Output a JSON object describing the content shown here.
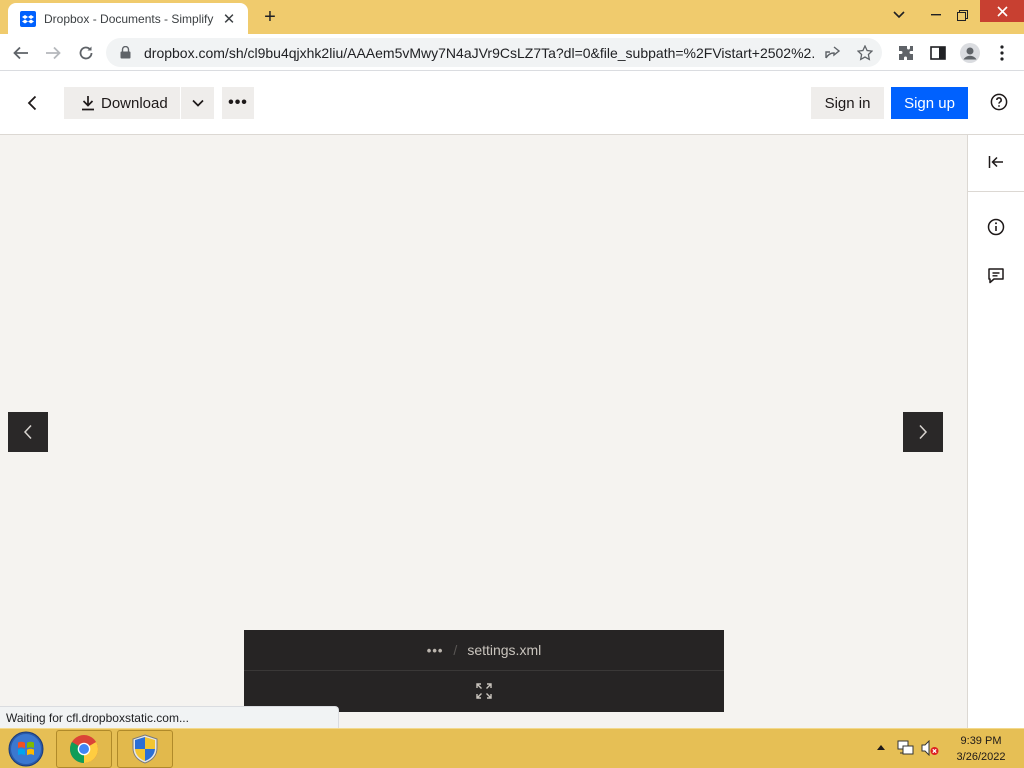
{
  "browser": {
    "tab_title": "Dropbox - Documents - Simplify",
    "new_tab_label": "+",
    "url": "dropbox.com/sh/cl9bu4qjxhk2liu/AAAem5vMwy7N4aJVr9CsLZ7Ta?dl=0&file_subpath=%2FVistart+2502%2..."
  },
  "header": {
    "download_label": "Download",
    "more_label": "•••",
    "sign_in_label": "Sign in",
    "sign_up_label": "Sign up"
  },
  "viewer": {
    "path_ellipsis": "•••",
    "path_separator": "/",
    "file_name": "settings.xml"
  },
  "status_text": "Waiting for cfl.dropboxstatic.com...",
  "taskbar": {
    "time": "9:39 PM",
    "date": "3/26/2022"
  },
  "colors": {
    "accent": "#0061fe",
    "tabstrip": "#f0cb6d",
    "taskbar": "#e6bf55",
    "preview_bg": "#f5f3f0",
    "file_bar": "#262424"
  },
  "icons": [
    "dropbox-icon",
    "close-icon",
    "plus-icon",
    "chevron-down-icon",
    "minimize-icon",
    "restore-icon",
    "back-arrow-icon",
    "forward-arrow-icon",
    "reload-icon",
    "lock-icon",
    "share-icon",
    "star-icon",
    "extensions-icon",
    "sidepanel-icon",
    "profile-icon",
    "kebab-icon",
    "chevron-left-icon",
    "download-icon",
    "help-icon",
    "collapse-panel-icon",
    "info-icon",
    "comment-icon",
    "chevron-right-icon",
    "fullscreen-icon",
    "windows-start-icon",
    "chrome-icon",
    "shield-icon"
  ]
}
